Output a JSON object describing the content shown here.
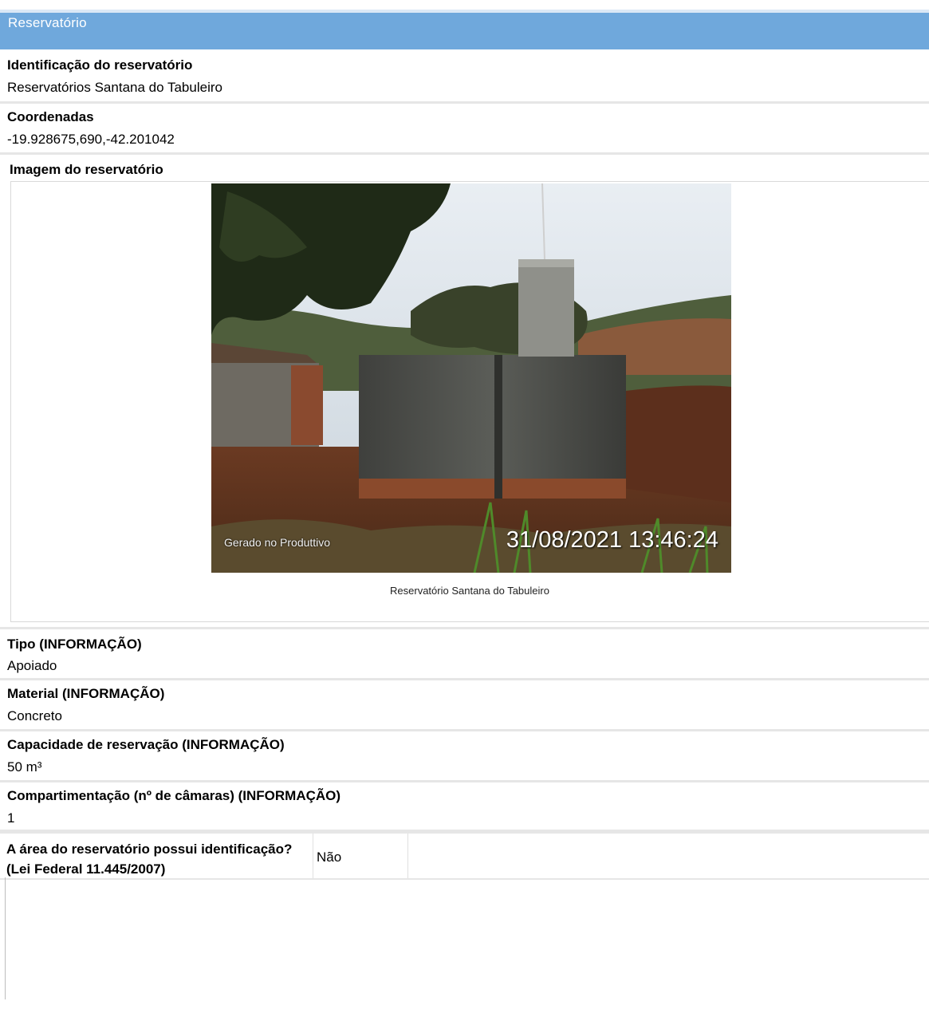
{
  "section": {
    "title": "Reservatório"
  },
  "fields": {
    "identificacao": {
      "label": "Identificação do reservatório",
      "value": "Reservatórios Santana do Tabuleiro"
    },
    "coordenadas": {
      "label": "Coordenadas",
      "value": "-19.928675,690,-42.201042"
    },
    "imagem": {
      "label": "Imagem do reservatório",
      "caption": "Reservatório Santana do Tabuleiro",
      "watermark": "Gerado no Produttivo",
      "timestamp": "31/08/2021 13:46:24"
    },
    "tipo": {
      "label": "Tipo (INFORMAÇÃO)",
      "value": "Apoiado"
    },
    "material": {
      "label": "Material (INFORMAÇÃO)",
      "value": "Concreto"
    },
    "capacidade": {
      "label": "Capacidade de reservação (INFORMAÇÃO)",
      "value": "50 m³"
    },
    "compartimentacao": {
      "label": "Compartimentação (nº de câmaras) (INFORMAÇÃO)",
      "value": "1"
    },
    "identificacao_area": {
      "label": "A área do reservatório possui identificação? (Lei Federal 11.445/2007)",
      "value": "Não"
    }
  },
  "colors": {
    "header": "#6fa8dc",
    "separator": "#e6e6e6"
  },
  "icons": {
    "photo": "reservoir-photo"
  }
}
